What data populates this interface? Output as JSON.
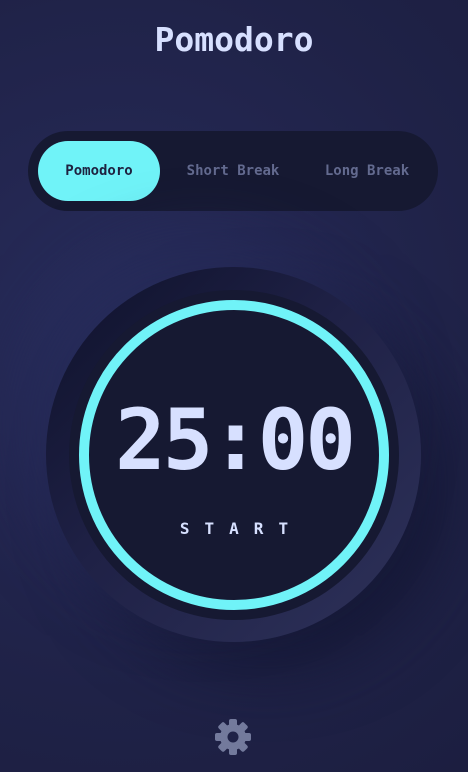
{
  "app": {
    "title": "Pomodoro"
  },
  "modes": {
    "items": [
      {
        "label": "Pomodoro",
        "active": true
      },
      {
        "label": "Short Break",
        "active": false
      },
      {
        "label": "Long Break",
        "active": false
      }
    ]
  },
  "timer": {
    "time": "25:00",
    "action_label": "START",
    "progress": 1.0,
    "accent_color": "#70f3f8"
  },
  "settings": {
    "icon": "gear-icon"
  },
  "colors": {
    "background": "#1e213f",
    "panel": "#161932",
    "text": "#d7e0ff",
    "muted_text": "#636a8f",
    "accent": "#70f3f8"
  }
}
